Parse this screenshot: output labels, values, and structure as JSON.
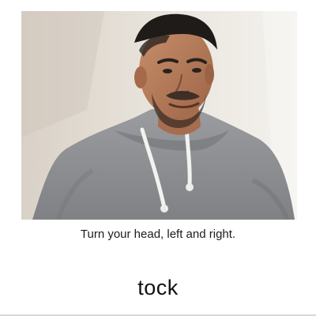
{
  "camera": {
    "preview_label": "camera-preview",
    "subject": "person-wearing-gray-hoodie"
  },
  "instruction": {
    "text": "Turn your head, left and right."
  },
  "status": {
    "word": "tock"
  },
  "colors": {
    "background": "#ffffff",
    "wall": "#e8e3da",
    "hoodie": "#8f9194",
    "text": "#111111"
  }
}
